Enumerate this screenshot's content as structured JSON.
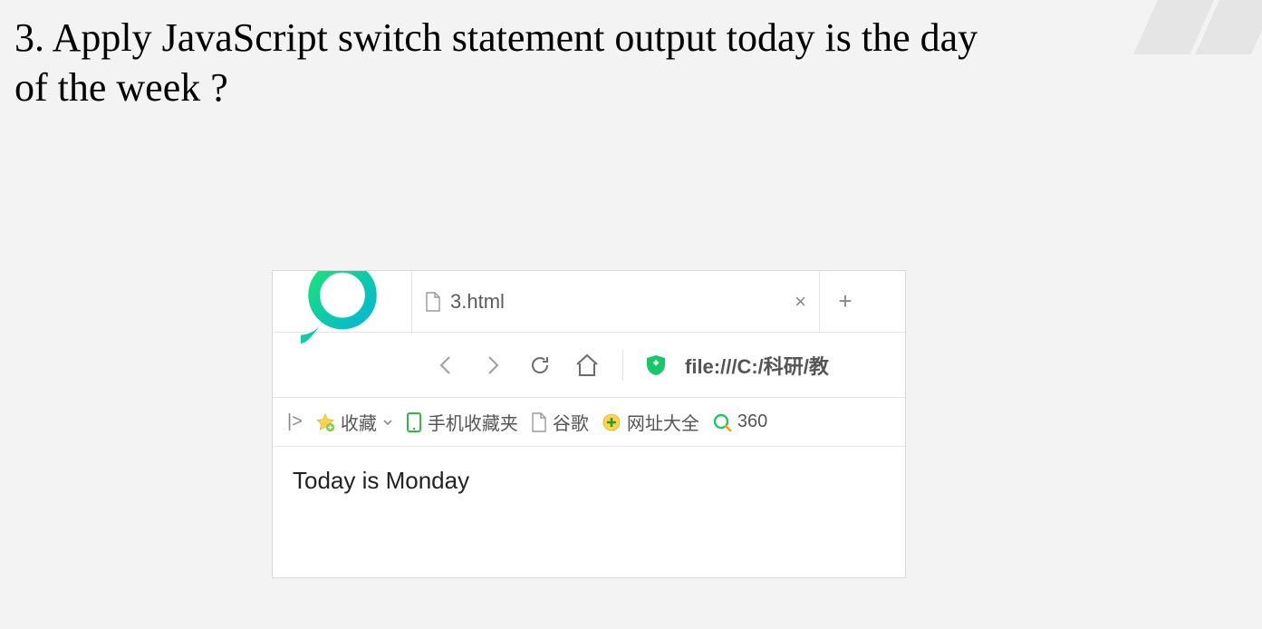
{
  "question": "3. Apply JavaScript switch statement output today is the day of the week ?",
  "browser": {
    "tab_title": "3.html",
    "url": "file:///C:/科研/教",
    "bookmarks": {
      "expand_glyph": "|>",
      "favorites": "收藏",
      "mobile_favorites": "手机收藏夹",
      "google": "谷歌",
      "site_directory": "网址大全",
      "search360": "360"
    },
    "page_output": "Today is Monday"
  }
}
